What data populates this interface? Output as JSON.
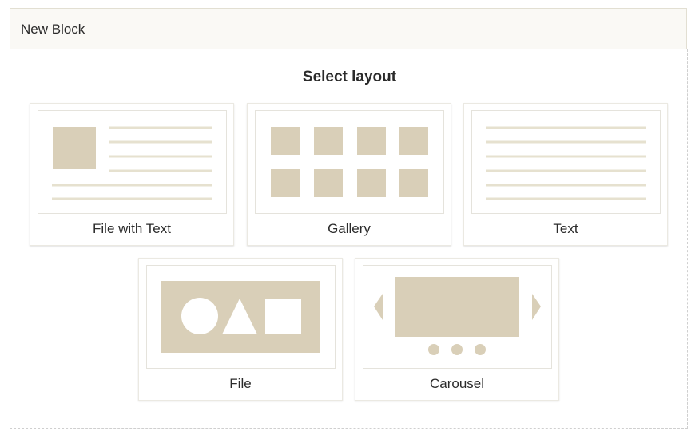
{
  "header": {
    "title": "New Block"
  },
  "main": {
    "title": "Select layout"
  },
  "layouts": [
    {
      "label": "File with Text"
    },
    {
      "label": "Gallery"
    },
    {
      "label": "Text"
    },
    {
      "label": "File"
    },
    {
      "label": "Carousel"
    }
  ],
  "colors": {
    "placeholder": "#d9cfb8",
    "line": "#e6e1cf",
    "header_bg": "#faf9f5"
  }
}
